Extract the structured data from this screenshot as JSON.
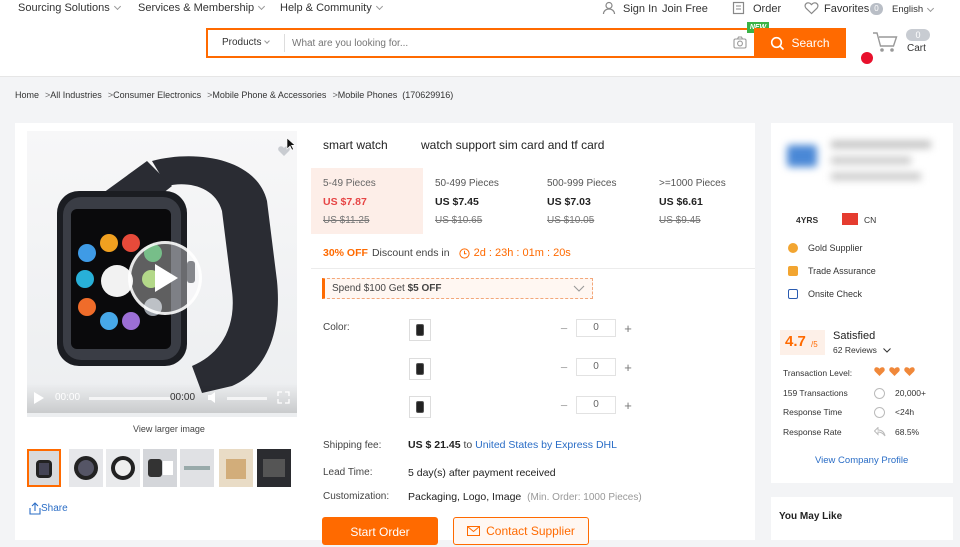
{
  "header": {
    "nav": [
      "Sourcing Solutions",
      "Services & Membership",
      "Help & Community"
    ],
    "sign_in": "Sign In",
    "join_free": "Join Free",
    "order": "Order",
    "favorites": "Favorites",
    "favorites_count": "0",
    "language": "English",
    "search_category": "Products",
    "search_placeholder": "What are you looking for...",
    "search_button": "Search",
    "new_badge": "NEW",
    "cart_label": "Cart",
    "cart_count": "0"
  },
  "breadcrumb": [
    "Home",
    "All Industries",
    "Consumer Electronics",
    "Mobile Phone & Accessories",
    "Mobile Phones"
  ],
  "breadcrumb_id": "(170629916)",
  "product": {
    "title_part1": "smart watch",
    "title_part2": "watch support sim card and tf card",
    "video_time_left": "00:00",
    "video_time_right": "00:00",
    "view_larger": "View larger image",
    "share": "Share",
    "price_tiers": [
      {
        "qty": "5-49 Pieces",
        "price": "US $7.87",
        "old": "US $11.25"
      },
      {
        "qty": "50-499 Pieces",
        "price": "US $7.45",
        "old": "US $10.65"
      },
      {
        "qty": "500-999 Pieces",
        "price": "US $7.03",
        "old": "US $10.05"
      },
      {
        "qty": ">=1000 Pieces",
        "price": "US $6.61",
        "old": "US $9.45"
      }
    ],
    "discount": "30% OFF",
    "discount_text": "Discount ends in",
    "countdown": "2d : 23h : 01m : 20s",
    "coupon_prefix": "Spend $100 Get ",
    "coupon_amount": "$5 OFF",
    "color_label": "Color:",
    "quantities": [
      "0",
      "0",
      "0"
    ],
    "shipping_label": "Shipping fee:",
    "shipping_price": "US $ 21.45",
    "shipping_to": "to",
    "shipping_link": "United States by Express DHL",
    "lead_label": "Lead Time:",
    "lead_value": "5 day(s) after payment received",
    "custom_label": "Customization:",
    "custom_value": "Packaging, Logo, Image",
    "custom_min": "(Min. Order: 1000 Pieces)",
    "start_order": "Start Order",
    "contact_supplier": "Contact Supplier"
  },
  "supplier": {
    "years": "4YRS",
    "country": "CN",
    "badges": [
      "Gold Supplier",
      "Trade Assurance",
      "Onsite Check"
    ],
    "rating": "4.7",
    "rating_max": "/5",
    "satisfied": "Satisfied",
    "reviews": "62 Reviews",
    "stats": [
      {
        "label": "Transaction Level:",
        "value": ""
      },
      {
        "label": "159 Transactions",
        "value": "20,000+"
      },
      {
        "label": "Response Time",
        "value": "<24h"
      },
      {
        "label": "Response Rate",
        "value": "68.5%"
      }
    ],
    "view_profile": "View Company Profile"
  },
  "you_may_like": "You May Like",
  "colors": {
    "accent": "#ff6a00",
    "link": "#2a6dc6",
    "price_red": "#e64545"
  }
}
